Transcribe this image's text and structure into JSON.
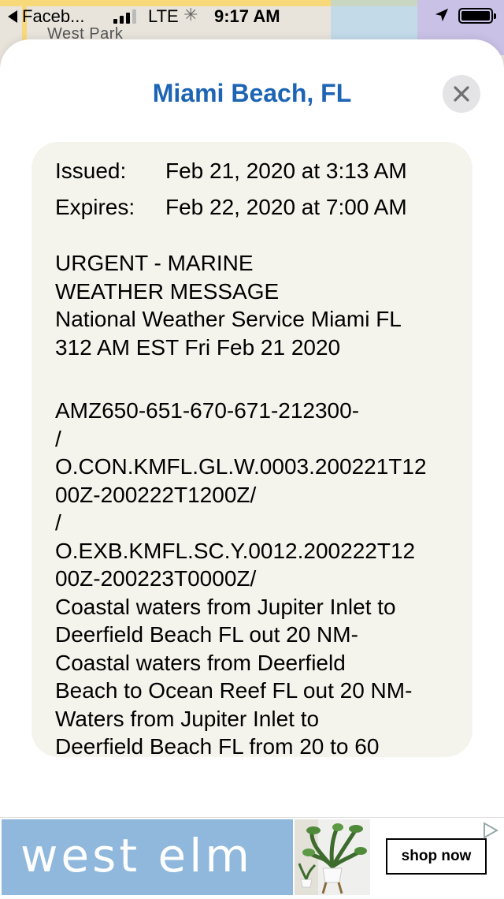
{
  "status_bar": {
    "back_app": "Faceb...",
    "network": "LTE",
    "time": "9:17 AM"
  },
  "map": {
    "label": "West Park"
  },
  "sheet": {
    "title": "Miami Beach, FL",
    "close_icon": "close-icon"
  },
  "alert": {
    "issued_label": "Issued:",
    "issued_value": "Feb 21, 2020 at 3:13 AM",
    "expires_label": "Expires:",
    "expires_value": "Feb 22, 2020 at 7:00 AM",
    "paragraph_1": "URGENT - MARINE\nWEATHER MESSAGE\nNational Weather Service Miami FL\n312 AM EST Fri Feb 21 2020",
    "paragraph_2": "AMZ650-651-670-671-212300-\n/\nO.CON.KMFL.GL.W.0003.200221T12\n00Z-200222T1200Z/\n/\nO.EXB.KMFL.SC.Y.0012.200222T12\n00Z-200223T0000Z/\nCoastal waters from Jupiter Inlet to\nDeerfield Beach FL out 20 NM-\nCoastal waters from Deerfield\nBeach to Ocean Reef FL out 20 NM-\nWaters from Jupiter Inlet to\nDeerfield Beach FL from 20 to 60"
  },
  "pager": {
    "pages": 1,
    "current": 1
  },
  "ad": {
    "brand": "west elm",
    "cta": "shop now",
    "brand_color": "#8fb8dc"
  },
  "colors": {
    "accent": "#1d64b4",
    "card_bg": "#f4f4ec"
  }
}
